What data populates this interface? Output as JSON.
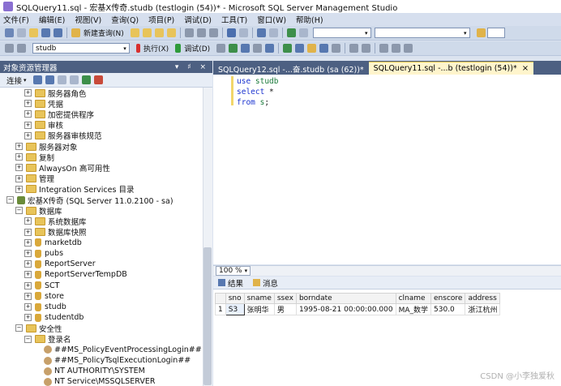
{
  "window": {
    "title": "SQLQuery11.sql - 宏基X传奇.studb (testlogin (54))* - Microsoft SQL Server Management Studio"
  },
  "menu": [
    "文件(F)",
    "编辑(E)",
    "视图(V)",
    "查询(Q)",
    "项目(P)",
    "调试(D)",
    "工具(T)",
    "窗口(W)",
    "帮助(H)"
  ],
  "toolbar": {
    "new_query": "新建查询(N)",
    "database": "studb",
    "execute": "执行(X)",
    "debug": "调试(D)"
  },
  "object_explorer": {
    "title": "对象资源管理器",
    "controls": "▾ ♯ ×",
    "connect": "连接",
    "tree": [
      {
        "label": "服务器角色",
        "indent": 2,
        "exp": "+",
        "icon": "folder"
      },
      {
        "label": "凭据",
        "indent": 2,
        "exp": "+",
        "icon": "folder"
      },
      {
        "label": "加密提供程序",
        "indent": 2,
        "exp": "+",
        "icon": "folder"
      },
      {
        "label": "审核",
        "indent": 2,
        "exp": "+",
        "icon": "folder"
      },
      {
        "label": "服务器审核规范",
        "indent": 2,
        "exp": "+",
        "icon": "folder"
      },
      {
        "label": "服务器对象",
        "indent": 1,
        "exp": "+",
        "icon": "folder"
      },
      {
        "label": "复制",
        "indent": 1,
        "exp": "+",
        "icon": "folder"
      },
      {
        "label": "AlwaysOn 高可用性",
        "indent": 1,
        "exp": "+",
        "icon": "folder"
      },
      {
        "label": "管理",
        "indent": 1,
        "exp": "+",
        "icon": "folder"
      },
      {
        "label": "Integration Services 目录",
        "indent": 1,
        "exp": "+",
        "icon": "folder"
      },
      {
        "label": "宏基X传奇 (SQL Server 11.0.2100 - sa)",
        "indent": 0,
        "exp": "−",
        "icon": "server"
      },
      {
        "label": "数据库",
        "indent": 1,
        "exp": "−",
        "icon": "folder"
      },
      {
        "label": "系统数据库",
        "indent": 2,
        "exp": "+",
        "icon": "folder"
      },
      {
        "label": "数据库快照",
        "indent": 2,
        "exp": "+",
        "icon": "folder"
      },
      {
        "label": "marketdb",
        "indent": 2,
        "exp": "+",
        "icon": "db"
      },
      {
        "label": "pubs",
        "indent": 2,
        "exp": "+",
        "icon": "db"
      },
      {
        "label": "ReportServer",
        "indent": 2,
        "exp": "+",
        "icon": "db"
      },
      {
        "label": "ReportServerTempDB",
        "indent": 2,
        "exp": "+",
        "icon": "db"
      },
      {
        "label": "SCT",
        "indent": 2,
        "exp": "+",
        "icon": "db"
      },
      {
        "label": "store",
        "indent": 2,
        "exp": "+",
        "icon": "db"
      },
      {
        "label": "studb",
        "indent": 2,
        "exp": "+",
        "icon": "db"
      },
      {
        "label": "studentdb",
        "indent": 2,
        "exp": "+",
        "icon": "db"
      },
      {
        "label": "安全性",
        "indent": 1,
        "exp": "−",
        "icon": "folder"
      },
      {
        "label": "登录名",
        "indent": 2,
        "exp": "−",
        "icon": "folder"
      },
      {
        "label": "##MS_PolicyEventProcessingLogin##",
        "indent": 3,
        "exp": "",
        "icon": "user"
      },
      {
        "label": "##MS_PolicyTsqlExecutionLogin##",
        "indent": 3,
        "exp": "",
        "icon": "user"
      },
      {
        "label": "NT AUTHORITY\\SYSTEM",
        "indent": 3,
        "exp": "",
        "icon": "user"
      },
      {
        "label": "NT Service\\MSSQLSERVER",
        "indent": 3,
        "exp": "",
        "icon": "user"
      }
    ]
  },
  "editor": {
    "tabs": [
      {
        "label": "SQLQuery12.sql -...奋.studb (sa (62))*",
        "active": false
      },
      {
        "label": "SQLQuery11.sql -...b (testlogin (54))*",
        "active": true
      }
    ],
    "close_glyph": "×",
    "lines": [
      [
        {
          "t": "use ",
          "c": "kw"
        },
        {
          "t": "studb",
          "c": "obj"
        }
      ],
      [
        {
          "t": "select ",
          "c": "kw"
        },
        {
          "t": "*",
          "c": "plain"
        }
      ],
      [
        {
          "t": "from ",
          "c": "kw"
        },
        {
          "t": "s",
          "c": "obj"
        },
        {
          "t": ";",
          "c": "plain"
        }
      ]
    ]
  },
  "zoom": "100 %",
  "results": {
    "tabs": [
      "结果",
      "消息"
    ],
    "columns": [
      "",
      "sno",
      "sname",
      "ssex",
      "borndate",
      "clname",
      "enscore",
      "address"
    ],
    "rows": [
      [
        "1",
        "S3",
        "张明华",
        "男",
        "1995-08-21 00:00:00.000",
        "MA_数学",
        "530.0",
        "浙江杭州"
      ]
    ]
  },
  "watermark": "CSDN @小李独爱秋"
}
